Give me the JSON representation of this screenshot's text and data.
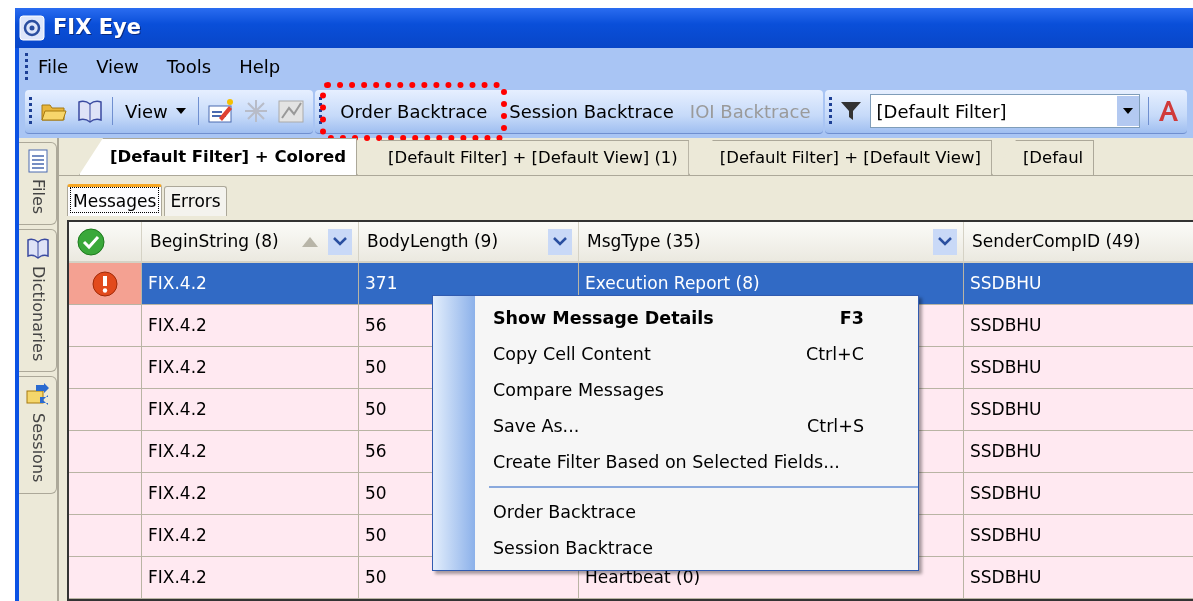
{
  "window": {
    "title": "FIX Eye"
  },
  "menu_bar": [
    "File",
    "View",
    "Tools",
    "Help"
  ],
  "toolbar": {
    "view_dropdown": "View",
    "backtrace_buttons": [
      {
        "label": "Order Backtrace",
        "disabled": false,
        "annotated": true
      },
      {
        "label": "Session Backtrace",
        "disabled": false,
        "annotated": false
      },
      {
        "label": "IOI Backtrace",
        "disabled": true,
        "annotated": false
      }
    ],
    "filter_combo": {
      "value": "[Default Filter]"
    }
  },
  "side_tabs": [
    {
      "label": "Files",
      "kind": "files"
    },
    {
      "label": "Dictionaries",
      "kind": "dictionaries"
    },
    {
      "label": "Sessions",
      "kind": "sessions"
    }
  ],
  "document_tabs": [
    {
      "label": "[Default Filter] + Colored",
      "selected": true
    },
    {
      "label": "[Default Filter] + [Default View] (1)",
      "selected": false
    },
    {
      "label": "[Default Filter] + [Default View]",
      "selected": false
    },
    {
      "label": "[Defaul",
      "selected": false
    }
  ],
  "view_tabs": [
    {
      "label": "Messages",
      "selected": true
    },
    {
      "label": "Errors",
      "selected": false
    }
  ],
  "table": {
    "columns": [
      {
        "label": "BeginString (8)",
        "sorted": true
      },
      {
        "label": "BodyLength (9)"
      },
      {
        "label": "MsgType (35)"
      },
      {
        "label": "SenderCompID (49)"
      }
    ],
    "rows": [
      {
        "selected": true,
        "error": true,
        "cells": [
          "FIX.4.2",
          "371",
          "Execution Report (8)",
          "SSDBHU"
        ]
      },
      {
        "selected": false,
        "error": false,
        "cells": [
          "FIX.4.2",
          "56",
          "",
          "SSDBHU"
        ]
      },
      {
        "selected": false,
        "error": false,
        "cells": [
          "FIX.4.2",
          "50",
          "",
          "SSDBHU"
        ]
      },
      {
        "selected": false,
        "error": false,
        "cells": [
          "FIX.4.2",
          "50",
          "",
          "SSDBHU"
        ]
      },
      {
        "selected": false,
        "error": false,
        "cells": [
          "FIX.4.2",
          "56",
          "",
          "SSDBHU"
        ]
      },
      {
        "selected": false,
        "error": false,
        "cells": [
          "FIX.4.2",
          "50",
          "",
          "SSDBHU"
        ]
      },
      {
        "selected": false,
        "error": false,
        "cells": [
          "FIX.4.2",
          "50",
          "",
          "SSDBHU"
        ]
      },
      {
        "selected": false,
        "error": false,
        "cells": [
          "FIX.4.2",
          "50",
          "Heartbeat (0)",
          "SSDBHU"
        ]
      }
    ]
  },
  "context_menu": [
    {
      "kind": "item",
      "label": "Show Message Details",
      "shortcut": "F3",
      "default": true
    },
    {
      "kind": "item",
      "label": "Copy Cell Content",
      "shortcut": "Ctrl+C",
      "default": false
    },
    {
      "kind": "item",
      "label": "Compare Messages",
      "default": false
    },
    {
      "kind": "item",
      "label": "Save As...",
      "shortcut": "Ctrl+S",
      "default": false
    },
    {
      "kind": "item",
      "label": "Create Filter Based on Selected Fields...",
      "default": false
    },
    {
      "kind": "separator"
    },
    {
      "kind": "item",
      "label": "Order Backtrace",
      "default": false
    },
    {
      "kind": "item",
      "label": "Session Backtrace",
      "default": false
    }
  ]
}
